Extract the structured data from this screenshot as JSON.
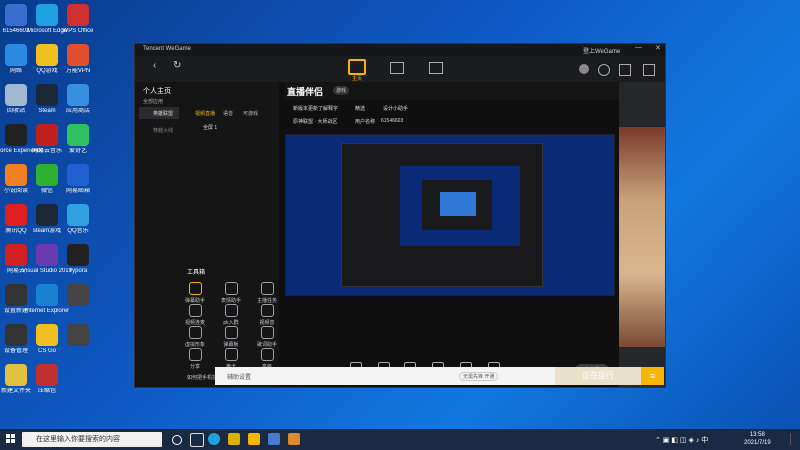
{
  "desktop": {
    "icons": [
      {
        "label": "61546603"
      },
      {
        "label": "Microsoft Edge"
      },
      {
        "label": "WPS Office"
      },
      {
        "label": "网络"
      },
      {
        "label": "QQ游戏"
      },
      {
        "label": "万能VPN"
      },
      {
        "label": "回收站"
      },
      {
        "label": "Steam"
      },
      {
        "label": "应用商店"
      },
      {
        "label": "GeForce Experience"
      },
      {
        "label": "网易云音乐"
      },
      {
        "label": "爱奇艺"
      },
      {
        "label": "小说阅读"
      },
      {
        "label": "微信"
      },
      {
        "label": "网易邮箱"
      },
      {
        "label": "腾讯QQ"
      },
      {
        "label": "steam游戏"
      },
      {
        "label": "QQ音乐"
      },
      {
        "label": "网易云"
      },
      {
        "label": "Visual Studio 2019"
      },
      {
        "label": "Typora"
      },
      {
        "label": "设置新建"
      },
      {
        "label": "Internet Explorer"
      },
      {
        "label": ""
      },
      {
        "label": "设备管理"
      },
      {
        "label": "CS Go"
      },
      {
        "label": ""
      },
      {
        "label": "新建文件夹"
      },
      {
        "label": "压缩包"
      }
    ]
  },
  "tencent_window": {
    "brand": "Tencent WeGame",
    "nav": {
      "home_label": "主页"
    },
    "user_label": "登上WeGame",
    "sidebar": {
      "section": "全部应用",
      "items": [
        {
          "label": "英雄联盟"
        },
        {
          "label": "穿越火线"
        }
      ]
    },
    "bottom_bar": {
      "search_placeholder": "辅助设置",
      "status_text": "无需先锋 开通",
      "start_label": "正在运行"
    }
  },
  "app": {
    "user_title": "个人主页",
    "logo_text": "直播伴侣",
    "badge": "游戏",
    "tabs": [
      {
        "label": "视频直播"
      },
      {
        "label": "语音"
      },
      {
        "label": "可游戏"
      }
    ],
    "scene_label": "全屏 1",
    "stream_info": [
      "新版本更新了解释字",
      "精选",
      "设计小助手"
    ],
    "stream_info2": [
      "原神联盟 · 大师战区",
      "用户名称",
      "61546603"
    ],
    "tools_header": "工具箱",
    "tools": [
      {
        "label": "弹幕助手"
      },
      {
        "label": "表情助手"
      },
      {
        "label": "主播任务"
      },
      {
        "label": "视频连麦"
      },
      {
        "label": "pk入群"
      },
      {
        "label": "视频音"
      },
      {
        "label": "虚拟形象"
      },
      {
        "label": "弹幕板"
      },
      {
        "label": "歌词助手"
      },
      {
        "label": "分享"
      },
      {
        "label": "声卡"
      },
      {
        "label": "高级"
      }
    ],
    "tip_text": "如何把手机拉近到直播间",
    "controls": [
      {
        "label": "直播屏幕"
      },
      {
        "label": "摄像头"
      },
      {
        "label": "手机投屏"
      },
      {
        "label": "多媒体"
      },
      {
        "label": "麦克风"
      },
      {
        "label": "扬声器"
      }
    ],
    "go_live_label": "去直播",
    "status_bar": [
      "CPU: 20%",
      "内存: 46%",
      "已推流 00:00:00",
      "上行速率 0kb/s"
    ]
  },
  "taskbar": {
    "search_placeholder": "在这里输入你要搜索的内容",
    "time": "13:58",
    "date": "2021/7/19"
  },
  "colors": {
    "accent": "#f7b500",
    "desktop_bg": "#0f5cc8",
    "window_bg": "#1e1f22"
  }
}
